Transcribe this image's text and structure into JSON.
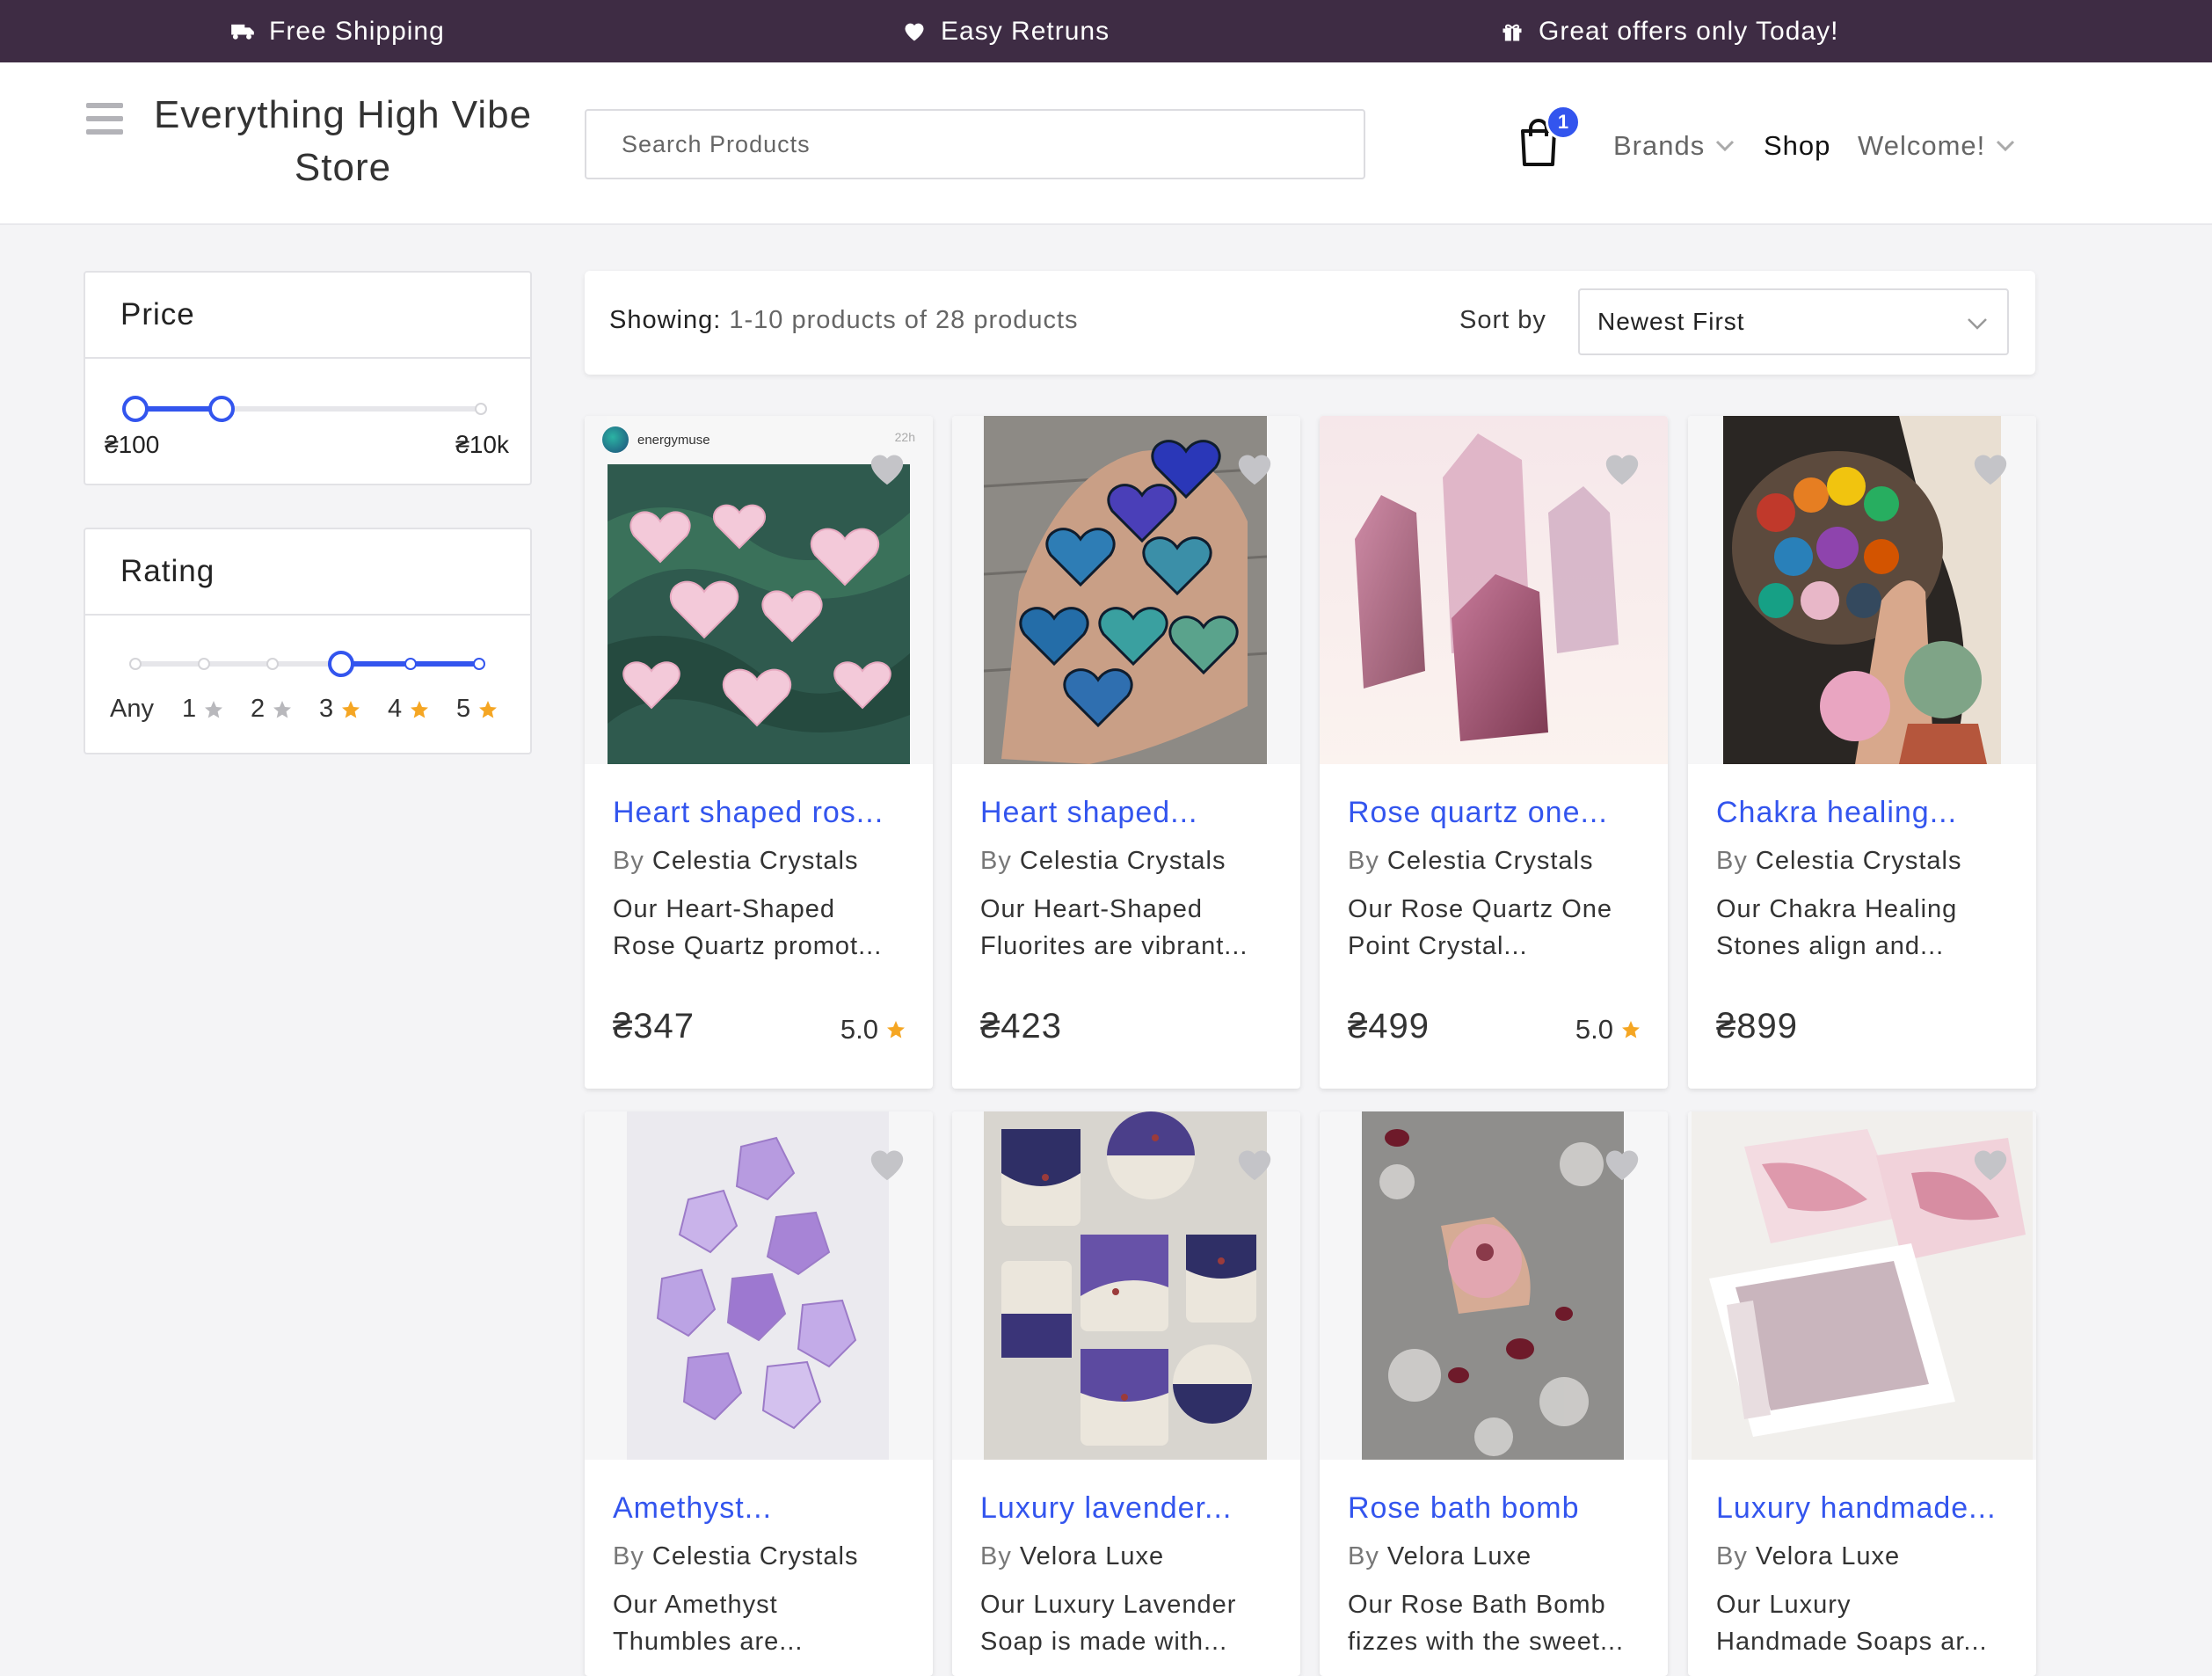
{
  "announcements": [
    {
      "icon": "truck-icon",
      "text": "Free Shipping"
    },
    {
      "icon": "heart-icon",
      "text": "Easy Retruns"
    },
    {
      "icon": "gift-icon",
      "text": "Great offers only Today!"
    }
  ],
  "header": {
    "store_title_line1": "Everything High Vibe",
    "store_title_line2": "Store",
    "search_placeholder": "Search Products",
    "cart_count": "1",
    "nav": {
      "brands": "Brands",
      "shop": "Shop",
      "welcome": "Welcome!"
    }
  },
  "filters": {
    "price": {
      "title": "Price",
      "min_label": "₴100",
      "max_label": "₴10k",
      "range_low_fraction": 0.0,
      "range_high_fraction": 0.25
    },
    "rating": {
      "title": "Rating",
      "options": [
        "Any",
        "1",
        "2",
        "3",
        "4",
        "5"
      ],
      "selected_min": "3",
      "selected_max": "5"
    }
  },
  "toolbar": {
    "showing_label": "Showing:",
    "showing_value": "1-10 products of 28 products",
    "sort_label": "Sort by",
    "sort_value": "Newest First"
  },
  "products": [
    {
      "title": "Heart shaped ros...",
      "by": "By",
      "brand": "Celestia Crystals",
      "desc1": "Our Heart-Shaped",
      "desc2": "Rose Quartz promot...",
      "price": "₴347",
      "rating": "5.0"
    },
    {
      "title": "Heart shaped...",
      "by": "By",
      "brand": "Celestia Crystals",
      "desc1": "Our Heart-Shaped",
      "desc2": "Fluorites are vibrant...",
      "price": "₴423",
      "rating": ""
    },
    {
      "title": "Rose quartz one...",
      "by": "By",
      "brand": "Celestia Crystals",
      "desc1": "Our Rose Quartz One",
      "desc2": "Point Crystal...",
      "price": "₴499",
      "rating": "5.0"
    },
    {
      "title": "Chakra healing...",
      "by": "By",
      "brand": "Celestia Crystals",
      "desc1": "Our Chakra Healing",
      "desc2": "Stones align and...",
      "price": "₴899",
      "rating": ""
    },
    {
      "title": "Amethyst...",
      "by": "By",
      "brand": "Celestia Crystals",
      "desc1": "Our Amethyst",
      "desc2": "Thumbles are...",
      "price": "",
      "rating": ""
    },
    {
      "title": "Luxury lavender...",
      "by": "By",
      "brand": "Velora Luxe",
      "desc1": "Our Luxury Lavender",
      "desc2": "Soap is made with...",
      "price": "",
      "rating": ""
    },
    {
      "title": "Rose bath bomb",
      "by": "By",
      "brand": "Velora Luxe",
      "desc1": "Our Rose Bath Bomb",
      "desc2": "fizzes with the sweet...",
      "price": "",
      "rating": ""
    },
    {
      "title": "Luxury handmade...",
      "by": "By",
      "brand": "Velora Luxe",
      "desc1": "Our Luxury",
      "desc2": "Handmade Soaps ar...",
      "price": "",
      "rating": ""
    }
  ],
  "image_overlay": {
    "account": "energymuse",
    "time": "22h"
  },
  "colors": {
    "topbar": "#3e2c44",
    "accent": "#3355ee",
    "star": "#f5a623",
    "star_inactive": "#b8b8bc"
  }
}
